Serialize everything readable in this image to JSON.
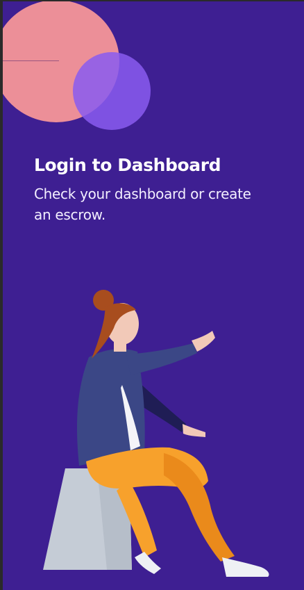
{
  "login": {
    "title": "Login to Dashboard",
    "subtitle": "Check your dashboard or create an escrow."
  },
  "illustration": {
    "icon": "woman-pointing-illustration"
  },
  "colors": {
    "background": "#3e1f92",
    "circle_pink": "#ec8f98",
    "circle_purple": "#8a5cf0",
    "jacket": "#3b4786",
    "pants": "#f7a12c",
    "hair": "#a84d1e",
    "skin": "#f2c9b8",
    "stool": "#c5ccd6"
  }
}
